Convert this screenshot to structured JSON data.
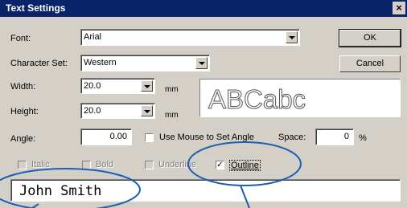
{
  "window": {
    "title": "Text Settings",
    "close_glyph": "×"
  },
  "font": {
    "label": "Font:",
    "value": "Arial"
  },
  "charset": {
    "label": "Character Set:",
    "value": "Western"
  },
  "width": {
    "label": "Width:",
    "value": "20.0",
    "unit": "mm"
  },
  "height": {
    "label": "Height:",
    "value": "20.0",
    "unit": "mm"
  },
  "preview": {
    "text": "ABCabc"
  },
  "angle": {
    "label": "Angle:",
    "value": "0.00"
  },
  "use_mouse": {
    "label": "Use Mouse to Set Angle",
    "checked": false
  },
  "space": {
    "label": "Space:",
    "value": "0",
    "unit": "%"
  },
  "styles": {
    "italic": {
      "label": "Italic",
      "enabled": false,
      "checked": false
    },
    "bold": {
      "label": "Bold",
      "enabled": false,
      "checked": false
    },
    "underline": {
      "label": "Underline",
      "enabled": false,
      "checked": false
    },
    "outline": {
      "label": "Outline",
      "enabled": true,
      "checked": true,
      "mark": "✓"
    }
  },
  "text_input": {
    "value": "John Smith"
  },
  "buttons": {
    "ok": "OK",
    "cancel": "Cancel"
  },
  "annotation_color": "#1a5fb4"
}
